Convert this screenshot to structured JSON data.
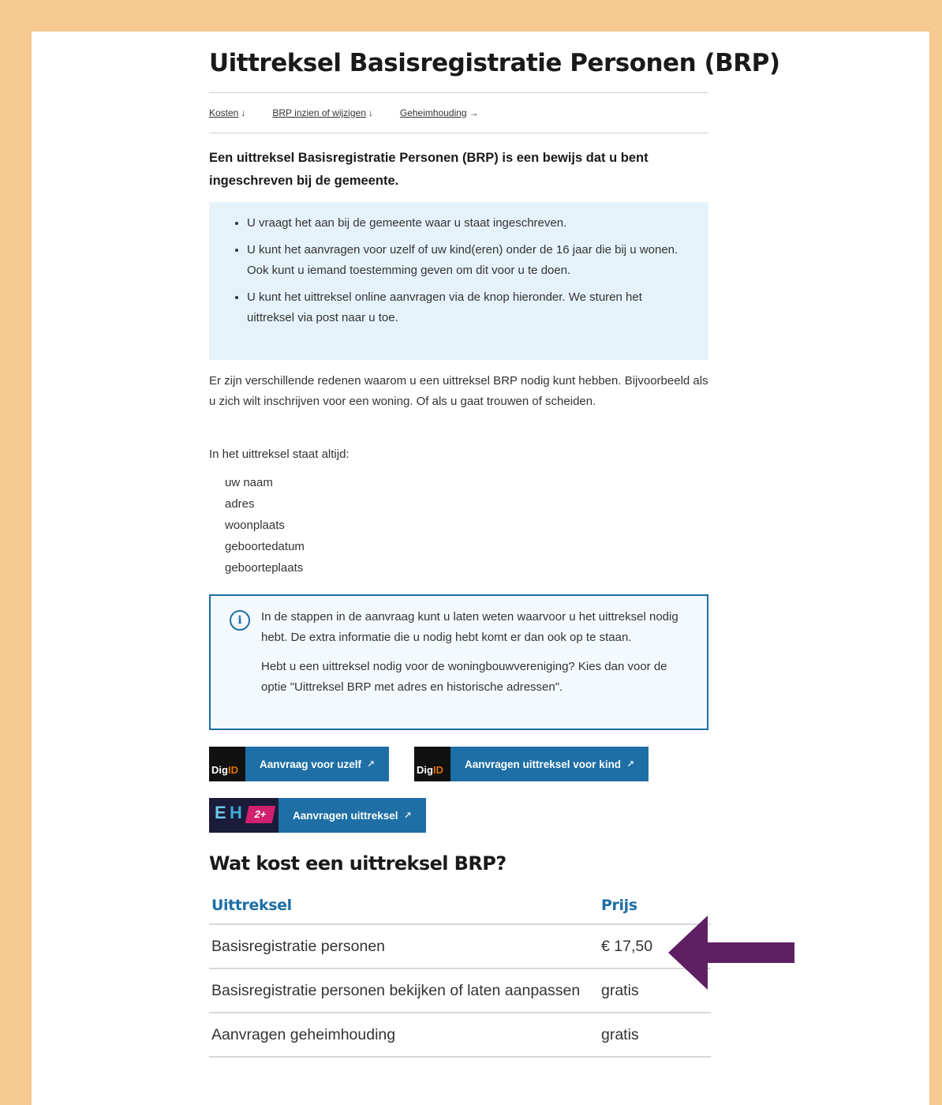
{
  "title": "Uittreksel Basisregistratie Personen (BRP)",
  "anchors": [
    {
      "label": "Kosten",
      "arrow": "↓"
    },
    {
      "label": "BRP inzien of wijzigen",
      "arrow": "↓"
    },
    {
      "label": "Geheimhouding",
      "arrow": "→"
    }
  ],
  "intro": "Een uittreksel Basisregistratie Personen (BRP) is een bewijs dat u bent ingeschreven bij de gemeente.",
  "bullets": [
    "U vraagt het aan bij de gemeente waar u staat ingeschreven.",
    "U kunt het aanvragen voor uzelf of uw kind(eren) onder de 16 jaar die bij u wonen. Ook kunt u iemand toestemming geven om dit voor u te doen.",
    "U kunt het uittreksel online aanvragen via de knop hieronder. We sturen het uittreksel via post naar u toe."
  ],
  "reasons": "Er zijn verschillende redenen waarom u een uittreksel BRP nodig kunt hebben. Bijvoorbeeld als u zich wilt inschrijven voor een woning. Of als u gaat trouwen of scheiden.",
  "always_label": "In het uittreksel staat altijd:",
  "always_items": [
    "uw naam",
    "adres",
    "woonplaats",
    "geboortedatum",
    "geboorteplaats"
  ],
  "info": {
    "icon": "info-icon",
    "p1": "In de stappen in de aanvraag kunt u laten weten waarvoor u het uittreksel nodig hebt. De extra informatie die u nodig hebt komt er dan ook op te staan.",
    "p2": "Hebt u een uittreksel nodig voor de woningbouwvereniging? Kies dan voor de optie \"Uittreksel BRP met adres en historische adressen\"."
  },
  "buttons": {
    "self": {
      "logo_a": "Dig",
      "logo_b": "ID",
      "label": "Aanvraag voor uzelf",
      "icon": "external-link-icon"
    },
    "child": {
      "logo_a": "Dig",
      "logo_b": "ID",
      "label": "Aanvragen uittreksel voor kind",
      "icon": "external-link-icon"
    },
    "eh": {
      "logo_e": "E",
      "logo_h": "H",
      "logo_badge": "2+",
      "label": "Aanvragen uittreksel",
      "icon": "external-link-icon"
    }
  },
  "costs": {
    "heading": "Wat kost een uittreksel BRP?",
    "col_item": "Uittreksel",
    "col_price": "Prijs",
    "rows": [
      {
        "item": "Basisregistratie personen",
        "price": "€ 17,50"
      },
      {
        "item": "Basisregistratie personen bekijken of laten aanpassen",
        "price": "gratis"
      },
      {
        "item": "Aanvragen geheimhouding",
        "price": "gratis"
      }
    ]
  },
  "colors": {
    "frame": "#f5c98f",
    "accent": "#1d6fa5",
    "bluebox": "#e6f2fa",
    "arrow": "#5e1f63",
    "digid_orange": "#e17000"
  }
}
